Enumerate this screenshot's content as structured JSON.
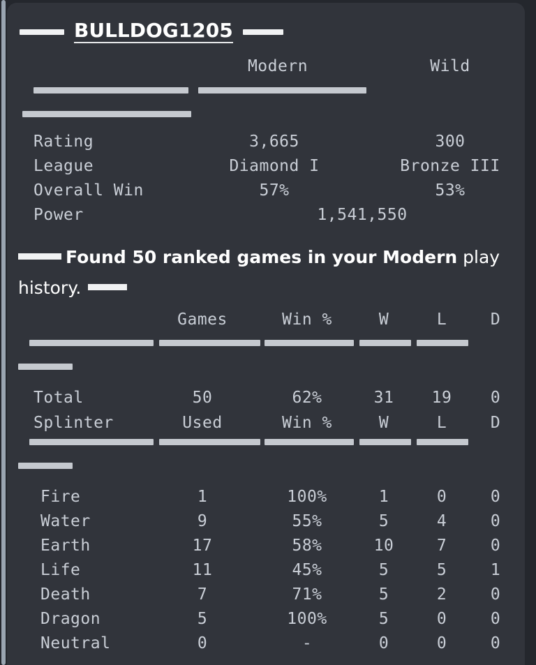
{
  "colors": {
    "page_background": "#24272d",
    "card_background": "#31343b",
    "mono_text": "#c9ced6",
    "heading_text": "#ffffff",
    "redaction_bar": "#f1f2f3",
    "separator_bar": "#c5c9cf",
    "scrollbar": "#9aa5b1"
  },
  "profile": {
    "name": "BULLDOG1205",
    "columns": [
      "Modern",
      "Wild"
    ],
    "rows": [
      {
        "label": "Rating",
        "modern": "3,665",
        "wild": "300"
      },
      {
        "label": "League",
        "modern": "Diamond I",
        "wild": "Bronze III"
      },
      {
        "label": "Overall Win",
        "modern": "57%",
        "wild": "53%"
      },
      {
        "label": "Power",
        "spanned": "1,541,550"
      }
    ]
  },
  "found_message": {
    "prefix": "Found 50 ranked games in your ",
    "format": "Modern",
    "suffix": " play history."
  },
  "games_table": {
    "headers": [
      "",
      "Games",
      "Win %",
      "W",
      "L",
      "D"
    ],
    "total_row": {
      "label": "Total",
      "games": "50",
      "win_pct": "62%",
      "w": "31",
      "l": "19",
      "d": "0"
    },
    "splinter_headers": {
      "label": "Splinter",
      "games": "Used",
      "win_pct": "Win %",
      "w": "W",
      "l": "L",
      "d": "D"
    },
    "splinter_rows": [
      {
        "label": "Fire",
        "games": "1",
        "win_pct": "100%",
        "w": "1",
        "l": "0",
        "d": "0"
      },
      {
        "label": "Water",
        "games": "9",
        "win_pct": "55%",
        "w": "5",
        "l": "4",
        "d": "0"
      },
      {
        "label": "Earth",
        "games": "17",
        "win_pct": "58%",
        "w": "10",
        "l": "7",
        "d": "0"
      },
      {
        "label": "Life",
        "games": "11",
        "win_pct": "45%",
        "w": "5",
        "l": "5",
        "d": "1"
      },
      {
        "label": "Death",
        "games": "7",
        "win_pct": "71%",
        "w": "5",
        "l": "2",
        "d": "0"
      },
      {
        "label": "Dragon",
        "games": "5",
        "win_pct": "100%",
        "w": "5",
        "l": "0",
        "d": "0"
      },
      {
        "label": "Neutral",
        "games": "0",
        "win_pct": "-",
        "w": "0",
        "l": "0",
        "d": "0"
      }
    ]
  }
}
